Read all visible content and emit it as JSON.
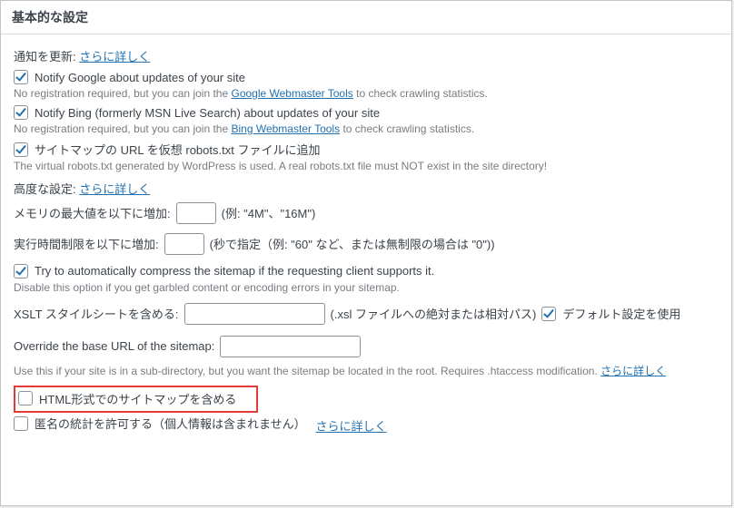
{
  "panel": {
    "title": "基本的な設定"
  },
  "notify_section": {
    "lead": "通知を更新:",
    "more": "さらに詳しく"
  },
  "notify_google": {
    "label": "Notify Google about updates of your site",
    "hint_before": "No registration required, but you can join the ",
    "hint_link": "Google Webmaster Tools",
    "hint_after": " to check crawling statistics."
  },
  "notify_bing": {
    "label": "Notify Bing (formerly MSN Live Search) about updates of your site",
    "hint_before": "No registration required, but you can join the ",
    "hint_link": "Bing Webmaster Tools",
    "hint_after": " to check crawling statistics."
  },
  "robots": {
    "label": "サイトマップの URL を仮想 robots.txt ファイルに追加",
    "hint": "The virtual robots.txt generated by WordPress is used. A real robots.txt file must NOT exist in the site directory!"
  },
  "advanced_section": {
    "lead": "高度な設定:",
    "more": "さらに詳しく"
  },
  "memory": {
    "label": "メモリの最大値を以下に増加:",
    "hint": "(例: \"4M\"、\"16M\")"
  },
  "time_limit": {
    "label": "実行時間制限を以下に増加:",
    "hint": "(秒で指定（例: \"60\" など、または無制限の場合は \"0\"))"
  },
  "gzip": {
    "label": "Try to automatically compress the sitemap if the requesting client supports it.",
    "hint": "Disable this option if you get garbled content or encoding errors in your sitemap."
  },
  "xslt": {
    "label": "XSLT スタイルシートを含める:",
    "hint": "(.xsl ファイルへの絶対または相対パス)",
    "default_label": "デフォルト設定を使用"
  },
  "base_url": {
    "label": "Override the base URL of the sitemap:",
    "hint_before": "Use this if your site is in a sub-directory, but you want the sitemap be located in the root. Requires .htaccess modification. ",
    "hint_link": "さらに詳しく"
  },
  "html_sitemap": {
    "label": "HTML形式でのサイトマップを含める"
  },
  "anon_stats": {
    "label": "匿名の統計を許可する（個人情報は含まれません）",
    "more": "さらに詳しく"
  }
}
